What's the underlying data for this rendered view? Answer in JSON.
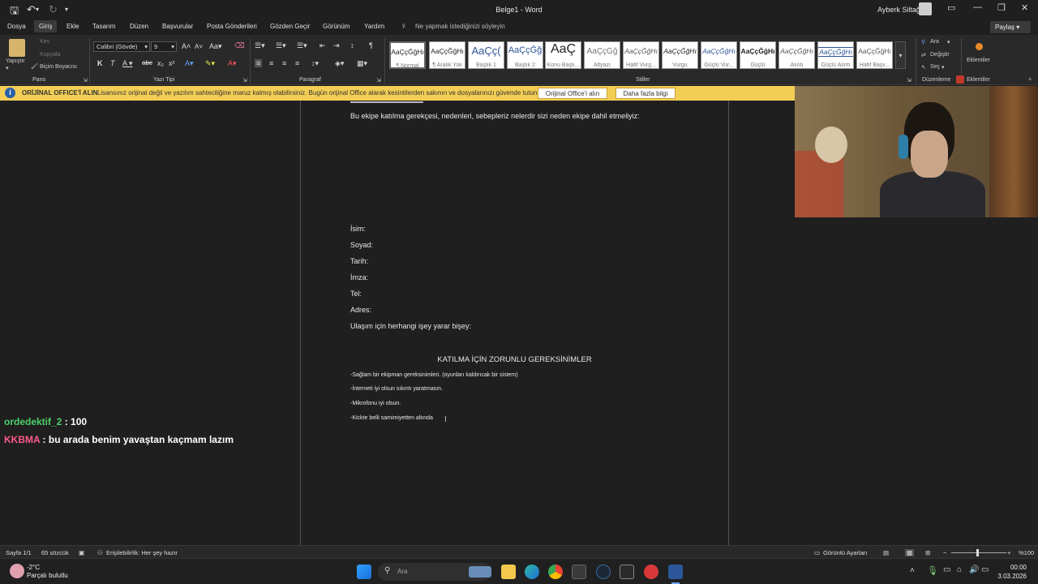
{
  "titlebar": {
    "doc_title": "Belge1 - Word",
    "user_name": "Ayberk Siltağ"
  },
  "ribbon_tabs": [
    "Dosya",
    "Giriş",
    "Ekle",
    "Tasarım",
    "Düzen",
    "Başvurular",
    "Posta Gönderileri",
    "Gözden Geçir",
    "Görünüm",
    "Yardım"
  ],
  "tell_me": "Ne yapmak istediğinizi söyleyin",
  "share": "Paylaş",
  "clipboard": {
    "paste": "Yapıştır",
    "cut": "Kes",
    "copy": "Kopyala",
    "format_painter": "Biçim Boyacısı",
    "label": "Pano"
  },
  "font": {
    "family": "Calibri (Gövde)",
    "size": "9",
    "label": "Yazı Tipi"
  },
  "paragraph": {
    "label": "Paragraf"
  },
  "styles": {
    "label": "Stiller",
    "items": [
      {
        "preview": "AaÇçĞğHı",
        "name": "¶ Normal"
      },
      {
        "preview": "AaÇçĞğHı",
        "name": "¶ Aralık Yok"
      },
      {
        "preview": "AaÇç(",
        "name": "Başlık 1"
      },
      {
        "preview": "AaÇçĞğ",
        "name": "Başlık 2"
      },
      {
        "preview": "AaÇ",
        "name": "Konu Başlı..."
      },
      {
        "preview": "AaÇçĞğ",
        "name": "Altyazı"
      },
      {
        "preview": "AaÇçĞğHı",
        "name": "Hafif Vurg..."
      },
      {
        "preview": "AaÇçĞğHı",
        "name": "Vurgu"
      },
      {
        "preview": "AaÇçĞğHı",
        "name": "Güçlü Vur..."
      },
      {
        "preview": "AaÇçĞğHı",
        "name": "Güçlü"
      },
      {
        "preview": "AaÇçĞğHı",
        "name": "Alıntı"
      },
      {
        "preview": "AaÇçĞğHı",
        "name": "Güçlü Alıntı"
      },
      {
        "preview": "AaÇçĞğHı",
        "name": "Hafif Başv..."
      }
    ]
  },
  "editing": {
    "find": "Ara",
    "replace": "Değiştir",
    "select": "Seç",
    "label": "Düzenleme"
  },
  "addins": {
    "label": "Eklentiler",
    "label2": "Eklentiler"
  },
  "infobar": {
    "title": "ORİJİNAL OFFICE'İ ALIN",
    "message": "Lisansınız orijinal değil ve yazılım sahteciliğine maruz kalmış olabilirsiniz. Bugün orijinal Office alarak kesintilerden sakının ve dosyalarınızı güvende tutun.",
    "btn_get": "Orijinal Office'i alın",
    "btn_more": "Daha fazla bilgi"
  },
  "document": {
    "question": "Bu ekipe katılma gerekçesi, nedenleri, sebepleriz nelerdir sizi neden ekipe dahil etmeliyiz:",
    "fields": [
      "İsim:",
      "Soyad:",
      "Tarih:",
      "İmza:",
      "Tel:",
      "Adres:"
    ],
    "contact": "Ulaşım için herhangi işey yarar bişey:",
    "heading": "KATILMA İÇİN ZORUNLU GEREKSİNİMLER",
    "req1": "-Sağlam bir ekipman gereksinimleri. (oyunları kaldırıcak bir sistem)",
    "req2": "-İnterneti iyi olsun sıkıntı yaratmasın.",
    "req3": "-Mikrofonu iyi olsun.",
    "req4": "-Kickte belli samimiyetten altında"
  },
  "chat": [
    {
      "user": "ordedektif_2",
      "text": " : 100"
    },
    {
      "user": "KKBMA",
      "text": " : bu arada benim yavaştan kaçmam lazım"
    }
  ],
  "statusbar": {
    "page": "Sayfa 1/1",
    "words": "65 sözcük",
    "accessibility": "Erişilebilirlik: Her şey hazır",
    "display_settings": "Görüntü Ayarları",
    "zoom": "%100"
  },
  "taskbar": {
    "weather_temp": "-2°C",
    "weather_desc": "Parçalı bulutlu",
    "search": "Ara",
    "time": "00:00",
    "date": "3.03.2026"
  }
}
